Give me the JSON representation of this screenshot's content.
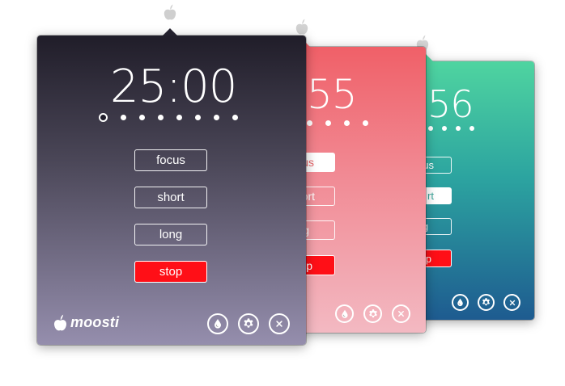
{
  "app": {
    "brand_name": "moosti",
    "icon": "moosti-apple-icon"
  },
  "windows": [
    {
      "id": "main",
      "timer": "25:00",
      "session_dots": 8,
      "active_dot": 0,
      "buttons": {
        "focus": "focus",
        "short": "short",
        "long": "long",
        "stop": "stop"
      },
      "toolbar_icons": [
        "color-drop-icon",
        "gear-icon",
        "close-icon"
      ],
      "colors": {
        "top": "#23202d",
        "bottom": "#958ead"
      }
    },
    {
      "id": "coral",
      "timer_visible": "55",
      "session_dots_visible": 4,
      "buttons_visible": {
        "focus": "us",
        "short": "ort",
        "long": "g",
        "stop": "p"
      },
      "toolbar_icons": [
        "color-drop-icon",
        "gear-icon",
        "close-icon"
      ],
      "colors": {
        "top": "#f06068",
        "bottom": "#f3b9c2"
      }
    },
    {
      "id": "teal",
      "timer_visible": "56",
      "session_dots_visible": 4,
      "buttons_visible": {
        "focus": "us",
        "short": "rt",
        "long": "g",
        "stop": "p"
      },
      "toolbar_icons": [
        "color-drop-icon",
        "gear-icon",
        "close-icon"
      ],
      "colors": {
        "top": "#4fd4a0",
        "bottom": "#1e5b90"
      }
    }
  ]
}
